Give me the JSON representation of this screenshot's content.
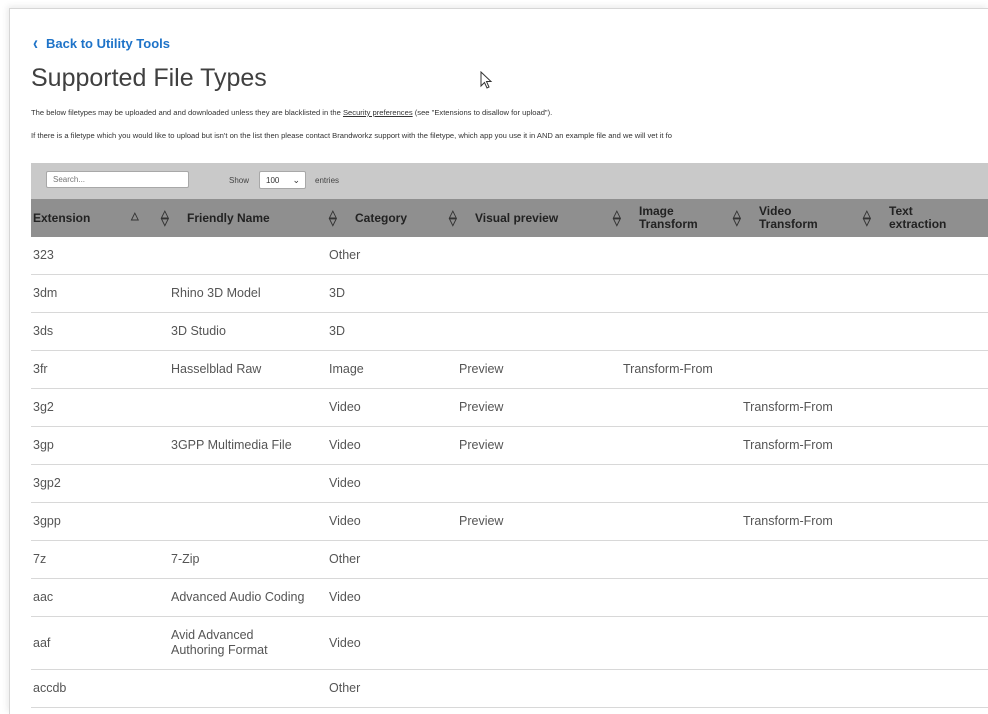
{
  "nav": {
    "back_label": "Back to Utility Tools"
  },
  "page": {
    "title": "Supported File Types",
    "desc1_prefix": "The below filetypes may be uploaded and and downloaded unless they are blacklisted in the ",
    "desc1_link": "Security preferences",
    "desc1_suffix": " (see \"Extensions to disallow for upload\").",
    "desc2": "If there is a filetype which you would like to upload but isn't on the list then please contact Brandworkz support with the filetype, which app you use it in AND an example file and we will vet it fo"
  },
  "toolbar": {
    "search_placeholder": "Search...",
    "show_label": "Show",
    "entries_value": "100",
    "entries_label": "entries"
  },
  "table": {
    "headers": [
      "Extension",
      "Friendly Name",
      "Category",
      "Visual preview",
      "Image Transform",
      "Video Transform",
      "Text extraction"
    ],
    "rows": [
      [
        "323",
        "",
        "Other",
        "",
        "",
        "",
        ""
      ],
      [
        "3dm",
        "Rhino 3D Model",
        "3D",
        "",
        "",
        "",
        ""
      ],
      [
        "3ds",
        "3D Studio",
        "3D",
        "",
        "",
        "",
        ""
      ],
      [
        "3fr",
        "Hasselblad Raw",
        "Image",
        "Preview",
        "Transform-From",
        "",
        ""
      ],
      [
        "3g2",
        "",
        "Video",
        "Preview",
        "",
        "Transform-From",
        ""
      ],
      [
        "3gp",
        "3GPP Multimedia File",
        "Video",
        "Preview",
        "",
        "Transform-From",
        ""
      ],
      [
        "3gp2",
        "",
        "Video",
        "",
        "",
        "",
        ""
      ],
      [
        "3gpp",
        "",
        "Video",
        "Preview",
        "",
        "Transform-From",
        ""
      ],
      [
        "7z",
        "7-Zip",
        "Other",
        "",
        "",
        "",
        ""
      ],
      [
        "aac",
        "Advanced Audio Coding",
        "Video",
        "",
        "",
        "",
        ""
      ],
      [
        "aaf",
        "Avid Advanced Authoring Format",
        "Video",
        "",
        "",
        "",
        ""
      ],
      [
        "accdb",
        "",
        "Other",
        "",
        "",
        "",
        ""
      ]
    ]
  },
  "icons": {
    "back": "chevron-left-icon",
    "sort": "sort-arrows-icon",
    "cursor": "mouse-pointer-icon"
  },
  "colors": {
    "link": "#1e73c8",
    "header_bg": "#8f8f8f",
    "toolbar_bg": "#c9c9c9"
  }
}
